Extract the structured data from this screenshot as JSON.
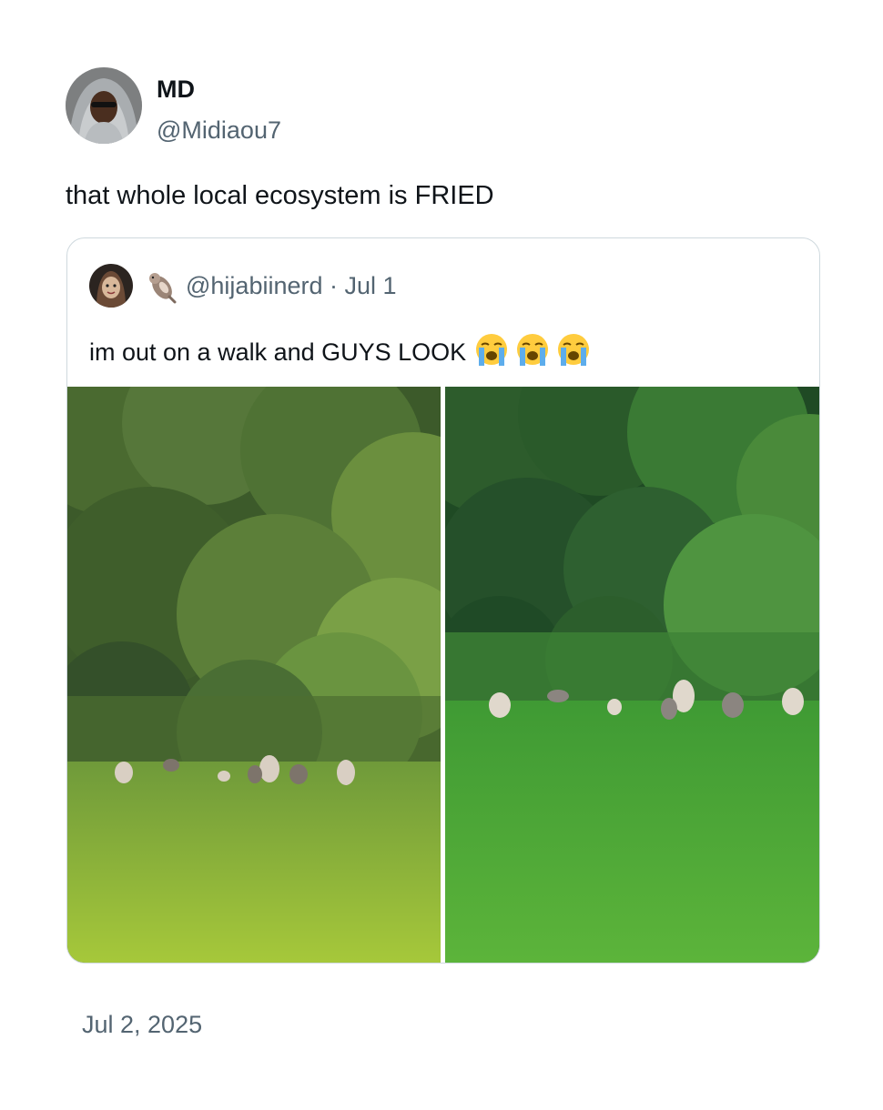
{
  "tweet": {
    "author": {
      "name": "MD",
      "handle": "@Midiaou7",
      "avatar_icon": "profile-photo-avatar"
    },
    "text": "that whole local ecosystem is FRIED",
    "timestamp": "Jul 2, 2025"
  },
  "quoted_tweet": {
    "handle_line": "@hijabiinerd · Jul 1",
    "name_emoji_icon": "otter-emoji-icon",
    "avatar_icon": "profile-photo-avatar",
    "text": "im out on a walk and GUYS LOOK",
    "trailing_emojis": [
      "loudly-crying-face-icon",
      "loudly-crying-face-icon",
      "loudly-crying-face-icon"
    ],
    "media": [
      {
        "name": "photo-left",
        "subject": "cats sitting on lawn in front of trees"
      },
      {
        "name": "photo-right",
        "subject": "cats sitting on lawn in front of trees"
      }
    ]
  },
  "colors": {
    "text_primary": "#0f1419",
    "text_secondary": "#536471",
    "card_border": "#cfd9de",
    "background": "#ffffff"
  }
}
